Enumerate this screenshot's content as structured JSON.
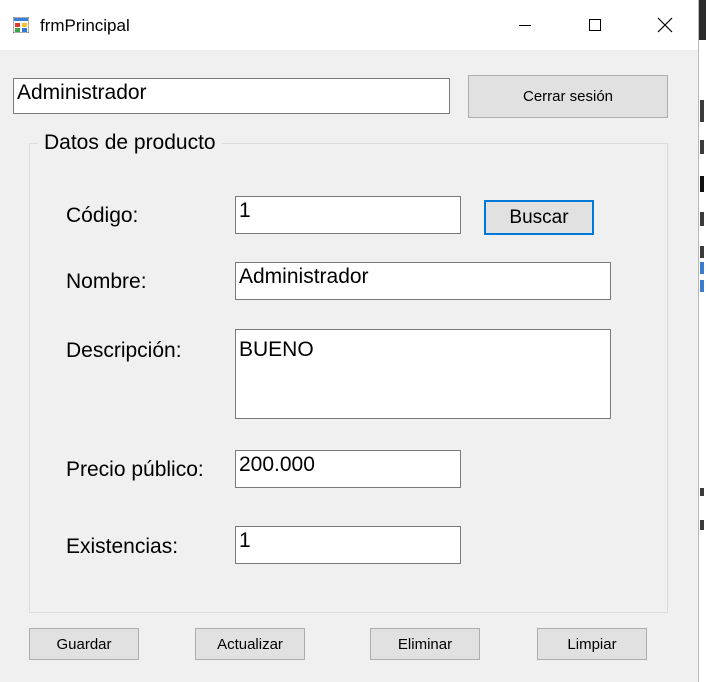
{
  "window": {
    "title": "frmPrincipal",
    "icons": {
      "app": "app-form-icon",
      "minimize": "minimize-icon",
      "maximize": "maximize-icon",
      "close": "close-icon"
    }
  },
  "session": {
    "user_value": "Administrador",
    "logout_label": "Cerrar sesión"
  },
  "product": {
    "group_title": "Datos de producto",
    "code_label": "Código:",
    "code_value": "1",
    "search_label": "Buscar",
    "name_label": "Nombre:",
    "name_value": "Administrador",
    "description_label": "Descripción:",
    "description_value": "BUENO",
    "price_label": "Precio público:",
    "price_value": "200.000",
    "stock_label": "Existencias:",
    "stock_value": "1"
  },
  "actions": {
    "save_label": "Guardar",
    "update_label": "Actualizar",
    "delete_label": "Eliminar",
    "clear_label": "Limpiar"
  },
  "colors": {
    "window_bg": "#f0f0f0",
    "focus_accent": "#0078d7",
    "button_bg": "#e1e1e1"
  }
}
